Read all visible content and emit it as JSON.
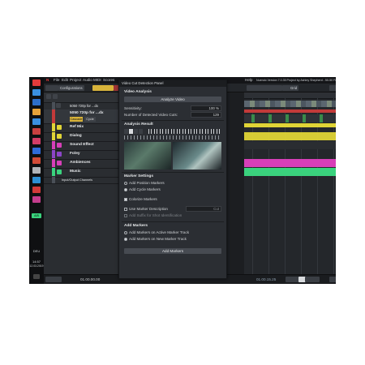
{
  "menu": {
    "items": [
      "File",
      "Edit",
      "Project",
      "Audio",
      "MIDI",
      "Scores"
    ],
    "help": "Help",
    "window_title": "Nuendo Version 7.0.35 Project by Ashley Shepherd - 50-50 Full Mix"
  },
  "toolbar": {
    "configurations": "Configurations",
    "grid": "Grid"
  },
  "taskbar": {
    "desk": "DEU",
    "time": "14:57",
    "date": "12.03.2019",
    "chip": "A/B"
  },
  "tracks": [
    {
      "label": "5050 720p for ...dx",
      "color": "#4a5058"
    },
    {
      "label": "5050 720p for ...dx",
      "color": "#c23a3a"
    },
    {
      "label": "Ref Mix",
      "color": "#e0d436"
    },
    {
      "label": "Dialog",
      "color": "#e0d436"
    },
    {
      "label": "Sound Effect",
      "color": "#d73fb8"
    },
    {
      "label": "Foley",
      "color": "#8c45c8"
    },
    {
      "label": "Ambiences",
      "color": "#d73fb8"
    },
    {
      "label": "Music",
      "color": "#3ad27d"
    },
    {
      "label": "Input/Output Channels",
      "color": "#4a5058"
    }
  ],
  "track_buttons": {
    "cascade": "Cascade",
    "cycle": "Cycle"
  },
  "panel": {
    "title": "Video Cut Detection Panel",
    "video_analysis": "Video Analysis",
    "analyze_button": "Analyze Video",
    "sensitivity_label": "Sensitivity:",
    "sensitivity_value": "100 %",
    "detected_label": "Number of Detected Video Cuts:",
    "detected_value": "129",
    "analysis_result": "Analysis Result",
    "marker_settings": "Marker Settings",
    "add_position": "Add Position Markers",
    "add_cycle": "Add Cycle Markers",
    "colorize": "Colorize Markers",
    "use_desc": "Use Marker Description",
    "desc_value": "Cut",
    "add_suffix": "Add Suffix for Shot Identification",
    "add_markers_head": "Add Markers",
    "on_active": "Add Markers on Active Marker Track",
    "on_new": "Add Markers on New Marker Track",
    "add_button": "Add Markers"
  },
  "bottom": {
    "time_left": "01.00.00.00",
    "time_right": "01.00.15.25"
  },
  "colors": {
    "accent_yellow": "#e0d436",
    "accent_pink": "#d73fb8",
    "accent_green": "#3ad27d",
    "accent_red": "#c23a3a"
  }
}
